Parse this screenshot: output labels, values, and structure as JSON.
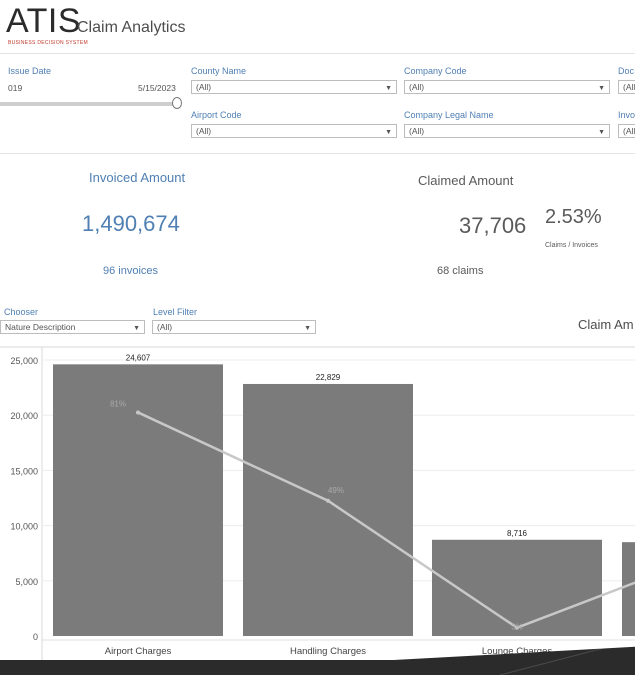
{
  "app": {
    "logo": "ATIS",
    "logo_tagline": "BUSINESS DECISION SYSTEM",
    "title": "Claim Analytics"
  },
  "filters": {
    "issue_date": {
      "label": "Issue Date",
      "start": "019",
      "end": "5/15/2023",
      "position": 1.0
    },
    "county_name": {
      "label": "County Name",
      "value": "(All)"
    },
    "airport_code": {
      "label": "Airport Code",
      "value": "(All)"
    },
    "company_code": {
      "label": "Company Code",
      "value": "(All)"
    },
    "company_legal_name": {
      "label": "Company Legal Name",
      "value": "(All)"
    },
    "doc": {
      "label": "Doc",
      "value": "(All"
    },
    "invo": {
      "label": "Invo",
      "value": "(All"
    },
    "chooser": {
      "label": "Chooser",
      "value": "Nature Description"
    },
    "level_filter": {
      "label": "Level Filter",
      "value": "(All)"
    }
  },
  "kpis": {
    "invoiced": {
      "title": "Invoiced Amount",
      "value": "1,490,674",
      "sub": "96 invoices"
    },
    "claimed": {
      "title": "Claimed Amount",
      "value": "37,706",
      "sub": "68 claims"
    },
    "ratio": {
      "value": "2.53%",
      "label": "Claims / Invoices"
    }
  },
  "chart_title": "Claim Am",
  "chart_data": {
    "type": "bar",
    "categories": [
      "Airport Charges",
      "Handling Charges",
      "Lounge Charges"
    ],
    "series": [
      {
        "values": [
          24607,
          22829,
          8716
        ]
      },
      {
        "values": [
          81,
          49,
          3
        ]
      }
    ],
    "bar_labels": [
      "24,607",
      "22,829",
      "8,716"
    ],
    "pct_labels": [
      "81%",
      "49%",
      "3%"
    ],
    "partial_next_bar_value": 8500,
    "partial_next_line_value": 20,
    "y_ticks": [
      "25,000",
      "20,000",
      "15,000",
      "10,000",
      "5,000",
      "0"
    ],
    "y_tick_values": [
      25000,
      20000,
      15000,
      10000,
      5000,
      0
    ],
    "ylim": [
      0,
      25000
    ],
    "y2lim": [
      0,
      100
    ],
    "grid": true,
    "colors": {
      "bar": "#7b7b7b",
      "line": "#c8c8c8"
    }
  }
}
